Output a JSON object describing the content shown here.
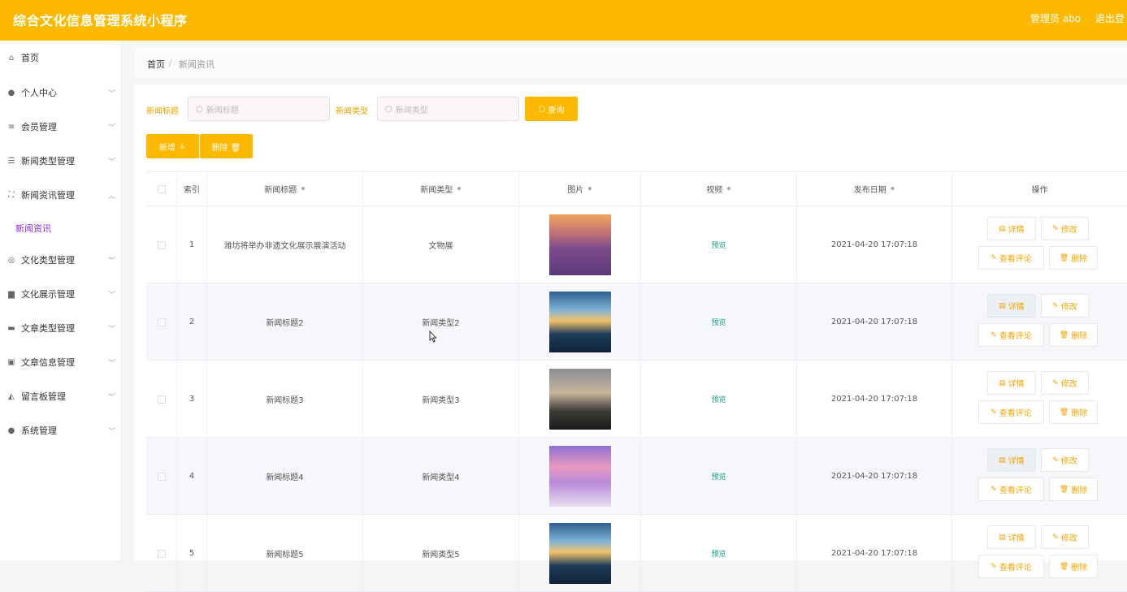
{
  "header": {
    "title": "综合文化信息管理系统小程序",
    "admin": "管理员 abo",
    "logout": "退出登"
  },
  "sidebar": {
    "items": [
      {
        "label": "首页",
        "icon": "home-icon",
        "glyph": "⌂",
        "chevron": false
      },
      {
        "label": "个人中心",
        "icon": "user-icon",
        "glyph": "●",
        "chevron": true
      },
      {
        "label": "会员管理",
        "icon": "menu-icon",
        "glyph": "≡",
        "chevron": true
      },
      {
        "label": "新闻类型管理",
        "icon": "sliders-icon",
        "glyph": "☰",
        "chevron": true
      },
      {
        "label": "新闻资讯管理",
        "icon": "expand-icon",
        "glyph": "⛶",
        "chevron": true
      },
      {
        "label": "文化类型管理",
        "icon": "compass-icon",
        "glyph": "◎",
        "chevron": true
      },
      {
        "label": "文化展示管理",
        "icon": "printer-icon",
        "glyph": "▆",
        "chevron": true
      },
      {
        "label": "文章类型管理",
        "icon": "ticket-icon",
        "glyph": "▬",
        "chevron": true
      },
      {
        "label": "文章信息管理",
        "icon": "briefcase-icon",
        "glyph": "▣",
        "chevron": true
      },
      {
        "label": "留言板管理",
        "icon": "mailbox-icon",
        "glyph": "◭",
        "chevron": true
      },
      {
        "label": "系统管理",
        "icon": "user-icon",
        "glyph": "●",
        "chevron": true
      }
    ],
    "sub_item": "新闻资讯"
  },
  "breadcrumb": {
    "home": "首页",
    "separator": "/",
    "current": "新闻资讯"
  },
  "search": {
    "title_label": "新闻标题",
    "title_placeholder": "新闻标题",
    "type_label": "新闻类型",
    "type_placeholder": "新闻类型",
    "query_button": "查询"
  },
  "actions": {
    "add": "新增 ＋",
    "delete": "删除 🗑"
  },
  "table": {
    "headers": {
      "index": "索引",
      "title": "新闻标题",
      "type": "新闻类型",
      "image": "图片",
      "video": "视频",
      "date": "发布日期",
      "ops": "操作"
    },
    "rows": [
      {
        "index": "1",
        "title": "潍坊将举办非遗文化展示展演活动",
        "type": "文物展",
        "video": "预览",
        "date": "2021-04-20 17:07:18"
      },
      {
        "index": "2",
        "title": "新闻标题2",
        "type": "新闻类型2",
        "video": "预览",
        "date": "2021-04-20 17:07:18"
      },
      {
        "index": "3",
        "title": "新闻标题3",
        "type": "新闻类型3",
        "video": "预览",
        "date": "2021-04-20 17:07:18"
      },
      {
        "index": "4",
        "title": "新闻标题4",
        "type": "新闻类型4",
        "video": "预览",
        "date": "2021-04-20 17:07:18"
      },
      {
        "index": "5",
        "title": "新闻标题5",
        "type": "新闻类型5",
        "video": "预览",
        "date": "2021-04-20 17:07:18"
      }
    ],
    "ops": {
      "detail": "详情",
      "edit": "修改",
      "comments": "查看评论",
      "delete": "删除"
    }
  },
  "colors": {
    "accent": "#fdb900",
    "link_green": "#16a085",
    "sub_menu": "#8a2be2"
  }
}
